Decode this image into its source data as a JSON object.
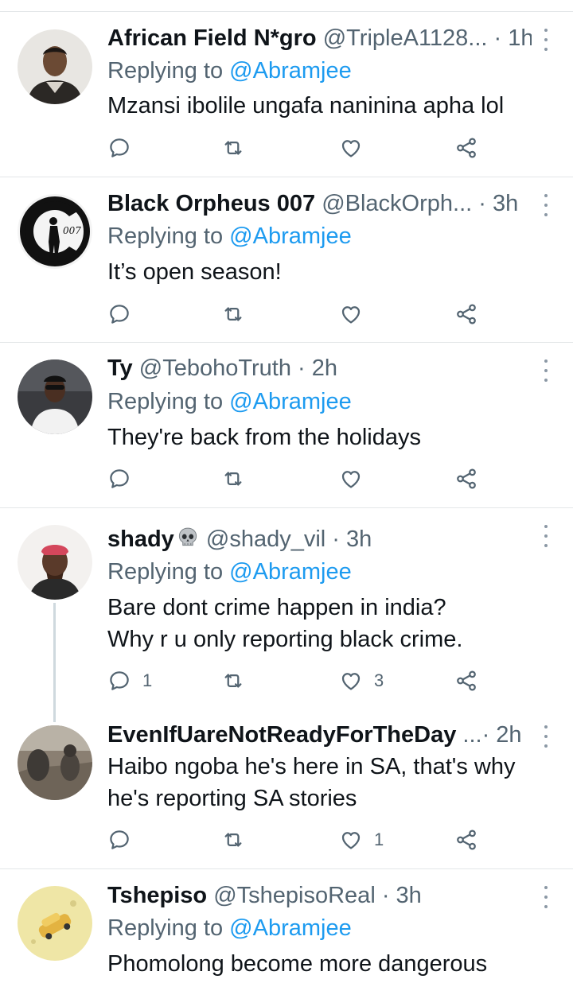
{
  "tweets": [
    {
      "name": "African Field N*gro",
      "handle": "@TripleA1128...",
      "time": "· 1h",
      "replying_prefix": "Replying to ",
      "replying_to": "@Abramjee",
      "text": "Mzansi ibolile ungafa naninina apha lol",
      "reply_count": "",
      "retweet_count": "",
      "like_count": ""
    },
    {
      "name": "Black Orpheus 007",
      "handle": "@BlackOrph...",
      "time": "· 3h",
      "replying_prefix": "Replying to ",
      "replying_to": "@Abramjee",
      "text": "It’s open season!",
      "reply_count": "",
      "retweet_count": "",
      "like_count": ""
    },
    {
      "name": "Ty",
      "handle": "@TebohoTruth",
      "time": "· 2h",
      "replying_prefix": "Replying to ",
      "replying_to": "@Abramjee",
      "text": "They're back from the holidays",
      "reply_count": "",
      "retweet_count": "",
      "like_count": ""
    },
    {
      "name": "shady",
      "handle": "@shady_vil",
      "time": "· 3h",
      "replying_prefix": "Replying to ",
      "replying_to": "@Abramjee",
      "text_line1": "Bare dont crime happen in india?",
      "text_line2": "Why r u only reporting  black crime.",
      "reply_count": "1",
      "retweet_count": "",
      "like_count": "3"
    },
    {
      "name": "EvenIfUareNotReadyForTheDay",
      "handle": "...",
      "time": "· 2h",
      "text_line1": "Haibo ngoba he's here in SA, that's why",
      "text_line2": "he's reporting SA stories",
      "reply_count": "",
      "retweet_count": "",
      "like_count": "1"
    },
    {
      "name": "Tshepiso",
      "handle": "@TshepisoReal",
      "time": "· 3h",
      "replying_prefix": "Replying to ",
      "replying_to": "@Abramjee",
      "text": "Phomolong become more dangerous"
    }
  ],
  "icons": {
    "reply": "reply-icon",
    "retweet": "retweet-icon",
    "like": "heart-icon",
    "share": "share-icon",
    "more": "more-options-icon"
  },
  "colors": {
    "mention": "#1d9bf0",
    "secondary_text": "#536471",
    "divider": "#e3e6e8"
  }
}
